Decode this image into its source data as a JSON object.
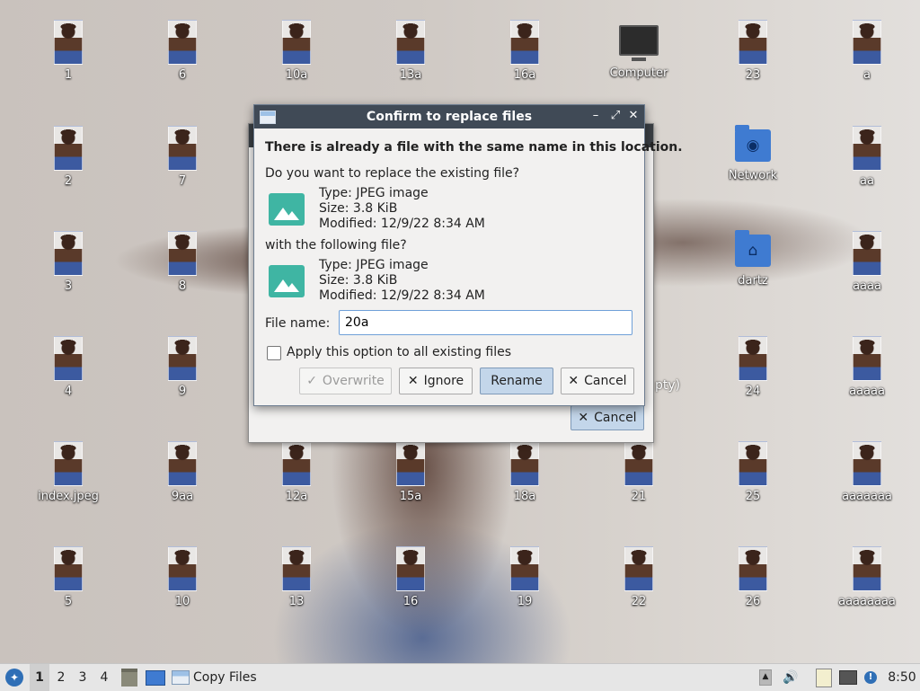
{
  "desktop": {
    "icons": [
      {
        "label": "1",
        "kind": "image"
      },
      {
        "label": "6",
        "kind": "image"
      },
      {
        "label": "10a",
        "kind": "image"
      },
      {
        "label": "13a",
        "kind": "image"
      },
      {
        "label": "16a",
        "kind": "image"
      },
      {
        "label": "Computer",
        "kind": "computer"
      },
      {
        "label": "23",
        "kind": "image"
      },
      {
        "label": "a",
        "kind": "image"
      },
      {
        "label": "2",
        "kind": "image"
      },
      {
        "label": "7",
        "kind": "image"
      },
      {
        "label": "Network",
        "kind": "folder-network"
      },
      {
        "label": "aa",
        "kind": "image"
      },
      {
        "label": "3",
        "kind": "image"
      },
      {
        "label": "8",
        "kind": "image"
      },
      {
        "label": "dartz",
        "kind": "folder-home"
      },
      {
        "label": "aaaa",
        "kind": "image"
      },
      {
        "label": "4",
        "kind": "image"
      },
      {
        "label": "9",
        "kind": "image"
      },
      {
        "label": "24",
        "kind": "image"
      },
      {
        "label": "aaaaa",
        "kind": "image"
      },
      {
        "label": "index.jpeg",
        "kind": "image"
      },
      {
        "label": "9aa",
        "kind": "image"
      },
      {
        "label": "12a",
        "kind": "image"
      },
      {
        "label": "15a",
        "kind": "image"
      },
      {
        "label": "18a",
        "kind": "image"
      },
      {
        "label": "21",
        "kind": "image"
      },
      {
        "label": "25",
        "kind": "image"
      },
      {
        "label": "aaaaaaa",
        "kind": "image"
      },
      {
        "label": "5",
        "kind": "image"
      },
      {
        "label": "10",
        "kind": "image"
      },
      {
        "label": "13",
        "kind": "image"
      },
      {
        "label": "16",
        "kind": "image"
      },
      {
        "label": "19",
        "kind": "image"
      },
      {
        "label": "22",
        "kind": "image"
      },
      {
        "label": "26",
        "kind": "image"
      },
      {
        "label": "aaaaaaaa",
        "kind": "image"
      }
    ],
    "partial_label": "pty)"
  },
  "copy_dialog": {
    "cancel_label": "Cancel"
  },
  "confirm_dialog": {
    "title": "Confirm to replace files",
    "heading": "There is already a file with the same name in this location.",
    "question": "Do you want to replace the existing file?",
    "existing": {
      "type": "Type: JPEG image",
      "size": "Size: 3.8 KiB",
      "modified": "Modified: 12/9/22 8:34 AM"
    },
    "with_label": "with the following file?",
    "new": {
      "type": "Type: JPEG image",
      "size": "Size: 3.8 KiB",
      "modified": "Modified: 12/9/22 8:34 AM"
    },
    "filename_label": "File name:",
    "filename_value": "20a",
    "apply_all_label": "Apply this option to all existing files",
    "apply_all_checked": false,
    "buttons": {
      "overwrite": "Overwrite",
      "ignore": "Ignore",
      "rename": "Rename",
      "cancel": "Cancel"
    }
  },
  "taskbar": {
    "workspaces": [
      "1",
      "2",
      "3",
      "4"
    ],
    "active_workspace": "1",
    "task_label": "Copy Files",
    "clock": "8:50"
  }
}
